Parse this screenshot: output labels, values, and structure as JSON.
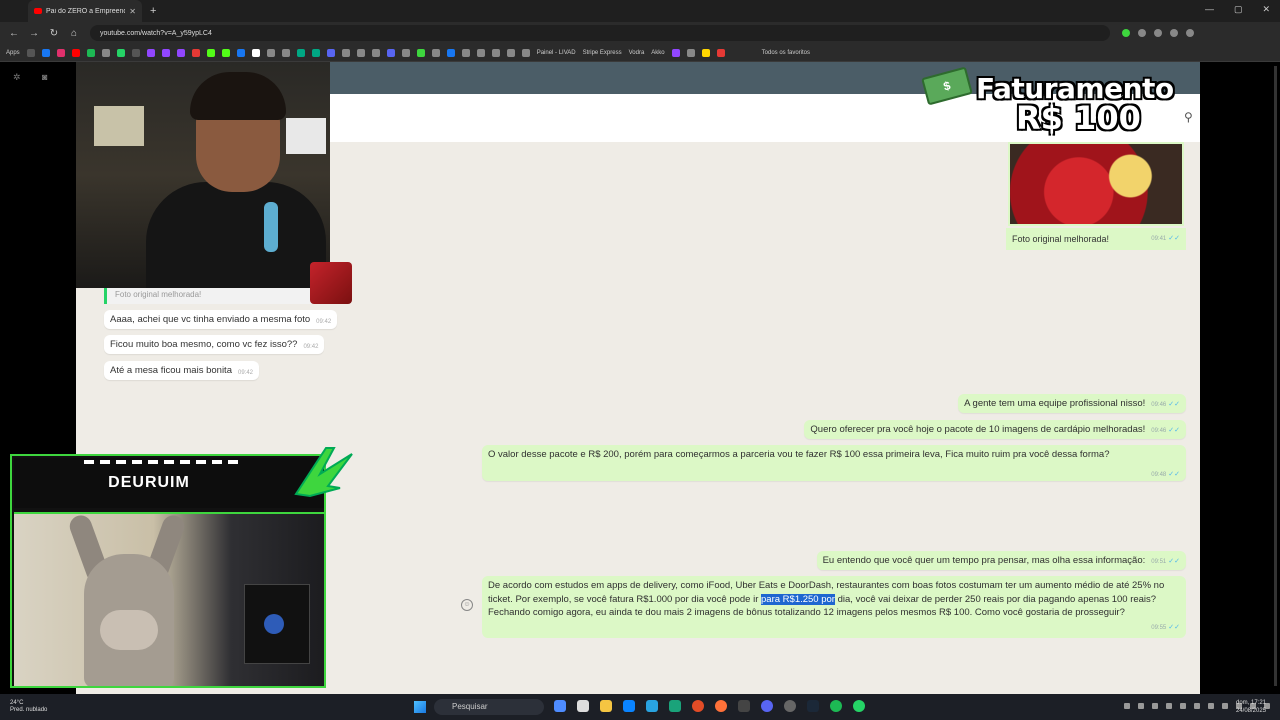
{
  "browser": {
    "tab_title": "Pai do ZERO a Empreended",
    "url": "youtube.com/watch?v=A_y59ypLC4",
    "bookmarks": {
      "apps": "Apps",
      "painel": "Painel - LIVAD",
      "stripe": "Stripe Express",
      "vodra": "Vodra",
      "akko": "Akko",
      "todos": "Todos os favoritos"
    }
  },
  "overlay": {
    "line1": "Faturamento",
    "line2": "R$ 100"
  },
  "chat": {
    "left_quote": "Foto original melhorada!",
    "left_messages": [
      {
        "text": "Aaaa, achei que vc tinha enviado a mesma foto",
        "time": "09:42"
      },
      {
        "text": "Ficou muito boa mesmo, como vc fez isso??",
        "time": "09:42"
      },
      {
        "text": "Até a mesa ficou mais bonita",
        "time": "09:42"
      }
    ],
    "photo_caption": "Foto original melhorada!",
    "photo_time": "09:41",
    "right_messages": [
      {
        "text": "A gente tem uma equipe profissional nisso!",
        "time": "09:46"
      },
      {
        "text": "Quero oferecer pra você hoje o pacote de 10 imagens de cardápio melhoradas!",
        "time": "09:46"
      },
      {
        "text": "O valor desse pacote e R$ 200, porém para começarmos a parceria vou te fazer R$ 100 essa primeira leva, Fica muito ruim pra você dessa forma?",
        "time": "09:48"
      },
      {
        "text": "Eu entendo que você quer um tempo pra pensar, mas olha essa informação:",
        "time": "09:51"
      }
    ],
    "long_message": {
      "part1": "De acordo com estudos em apps de delivery,  como iFood, Uber Eats e DoorDash, restaurantes com boas fotos costumam ter um aumento médio de até 25% no ticket. Por exemplo, se você fatura R$1.000 por dia você pode ir ",
      "highlight": "para R$1.250 por",
      "part2": " dia, você vai deixar de perder 250 reais por dia pagando apenas 100 reais? Fechando comigo agora, eu ainda te dou mais 2 imagens de bônus totalizando 12 imagens pelos mesmos R$ 100. Como você gostaria de prosseguir?",
      "time": "09:55"
    }
  },
  "streamer": {
    "name": "DEURUIM"
  },
  "taskbar": {
    "temp": "24°C",
    "weather": "Pred. nublado",
    "search": "Pesquisar",
    "time": "dom, 17:21",
    "date": "24/08/2025"
  },
  "colors": {
    "bubble_out": "#dcf8c6",
    "highlight": "#1e66d0",
    "frame": "#3ed63e"
  }
}
